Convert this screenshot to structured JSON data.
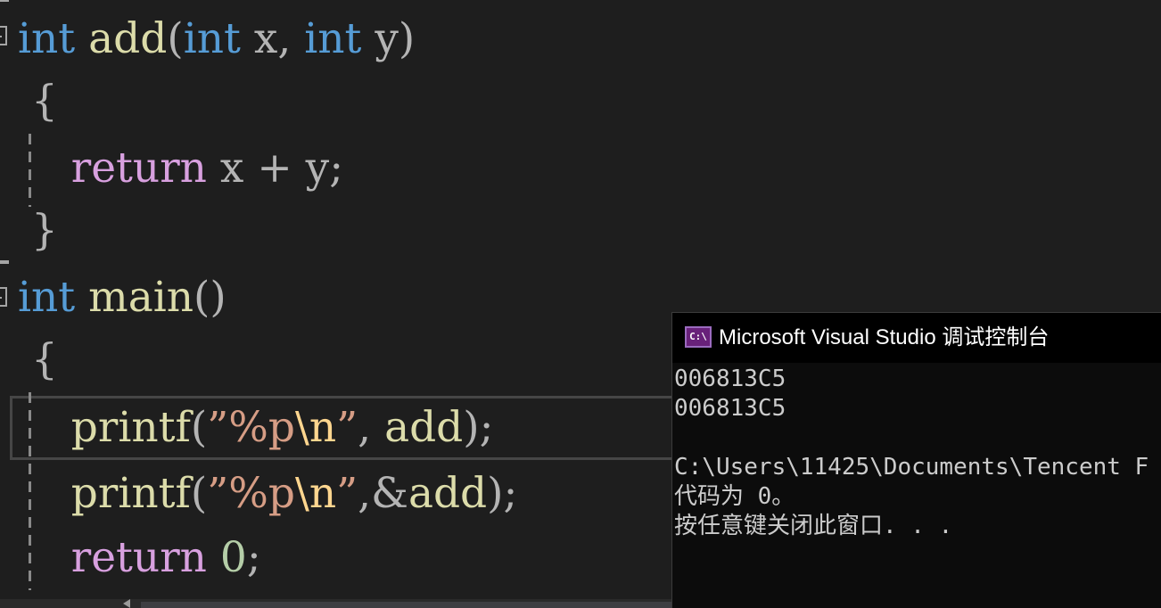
{
  "editor": {
    "lines": [
      [
        [
          "kw-type",
          "int"
        ],
        [
          "plain",
          " "
        ],
        [
          "fn",
          "add"
        ],
        [
          "plain",
          "("
        ],
        [
          "kw-type",
          "int"
        ],
        [
          "plain",
          " x, "
        ],
        [
          "kw-type",
          "int"
        ],
        [
          "plain",
          " y)"
        ]
      ],
      [
        [
          "plain",
          " {"
        ]
      ],
      [
        [
          "plain",
          "    "
        ],
        [
          "kw-ctrl",
          "return"
        ],
        [
          "plain",
          " x + y;"
        ]
      ],
      [
        [
          "plain",
          " }"
        ]
      ],
      [
        [
          "kw-type",
          "int"
        ],
        [
          "plain",
          " "
        ],
        [
          "fn",
          "main"
        ],
        [
          "plain",
          "()"
        ]
      ],
      [
        [
          "plain",
          " {"
        ]
      ],
      [
        [
          "plain",
          "    "
        ],
        [
          "fn",
          "printf"
        ],
        [
          "plain",
          "("
        ],
        [
          "str",
          "”%p"
        ],
        [
          "esc",
          "\\n"
        ],
        [
          "str",
          "”"
        ],
        [
          "plain",
          ", "
        ],
        [
          "fn",
          "add"
        ],
        [
          "plain",
          ");"
        ]
      ],
      [
        [
          "plain",
          "    "
        ],
        [
          "fn",
          "printf"
        ],
        [
          "plain",
          "("
        ],
        [
          "str",
          "”%p"
        ],
        [
          "esc",
          "\\n"
        ],
        [
          "str",
          "”"
        ],
        [
          "plain",
          ",&"
        ],
        [
          "fn",
          "add"
        ],
        [
          "plain",
          ");"
        ]
      ],
      [
        [
          "plain",
          "    "
        ],
        [
          "kw-ctrl",
          "return"
        ],
        [
          "plain",
          " "
        ],
        [
          "num",
          "0"
        ],
        [
          "plain",
          ";"
        ]
      ]
    ]
  },
  "console": {
    "title": "Microsoft Visual Studio 调试控制台",
    "icon": "console-app-icon",
    "icon_text": "C:\\",
    "output": [
      "006813C5",
      "006813C5",
      "",
      "C:\\Users\\11425\\Documents\\Tencent F",
      "代码为 0。",
      "按任意键关闭此窗口. . ."
    ]
  },
  "colors": {
    "background": "#1e1e1e",
    "keyword_type": "#569cd6",
    "keyword_control": "#d8a0df",
    "function": "#dcdcaa",
    "string": "#d69d85",
    "escape": "#ffd68f",
    "number": "#b5cea8",
    "console_bg": "#0c0c0c"
  }
}
